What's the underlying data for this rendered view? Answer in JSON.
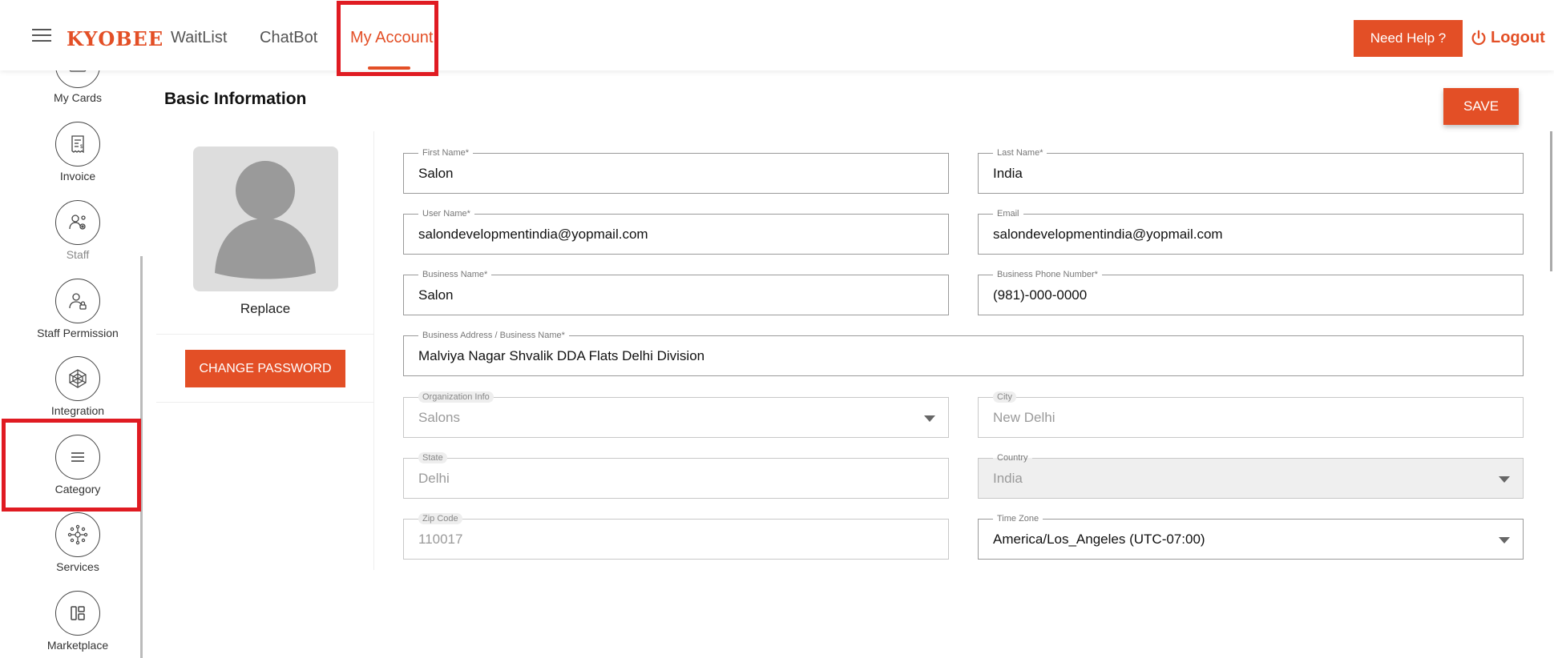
{
  "header": {
    "brand": "KYOBEE",
    "nav": [
      "WaitList",
      "ChatBot",
      "My Account"
    ],
    "need_help": "Need Help ?",
    "logout": "Logout"
  },
  "sidebar": {
    "items": [
      {
        "label": "My Cards",
        "icon": "card-icon"
      },
      {
        "label": "Invoice",
        "icon": "invoice-icon"
      },
      {
        "label": "Staff",
        "icon": "staff-icon"
      },
      {
        "label": "Staff Permission",
        "icon": "staff-permission-icon"
      },
      {
        "label": "Integration",
        "icon": "integration-icon"
      },
      {
        "label": "Category",
        "icon": "list-icon"
      },
      {
        "label": "Services",
        "icon": "services-icon"
      },
      {
        "label": "Marketplace",
        "icon": "marketplace-icon"
      }
    ]
  },
  "main": {
    "title": "Basic Information",
    "save": "SAVE",
    "replace": "Replace",
    "change_password": "CHANGE PASSWORD",
    "fields": {
      "first_name": {
        "label": "First Name*",
        "value": "Salon"
      },
      "last_name": {
        "label": "Last Name*",
        "value": "India"
      },
      "user_name": {
        "label": "User Name*",
        "value": "salondevelopmentindia@yopmail.com"
      },
      "email": {
        "label": "Email",
        "value": "salondevelopmentindia@yopmail.com"
      },
      "business_name": {
        "label": "Business Name*",
        "value": "Salon"
      },
      "business_phone": {
        "label": "Business Phone Number*",
        "value": "(981)-000-0000"
      },
      "business_address": {
        "label": "Business Address / Business Name*",
        "value": "Malviya Nagar Shvalik DDA Flats Delhi Division"
      },
      "organization": {
        "label": "Organization Info",
        "value": "Salons"
      },
      "city": {
        "label": "City",
        "value": "New Delhi"
      },
      "state": {
        "label": "State",
        "value": "Delhi"
      },
      "country": {
        "label": "Country",
        "value": "India"
      },
      "zip": {
        "label": "Zip Code",
        "value": "110017"
      },
      "timezone": {
        "label": "Time Zone",
        "value": "America/Los_Angeles (UTC-07:00)"
      }
    }
  },
  "colors": {
    "accent": "#e34f26",
    "highlight": "#e01b22"
  }
}
